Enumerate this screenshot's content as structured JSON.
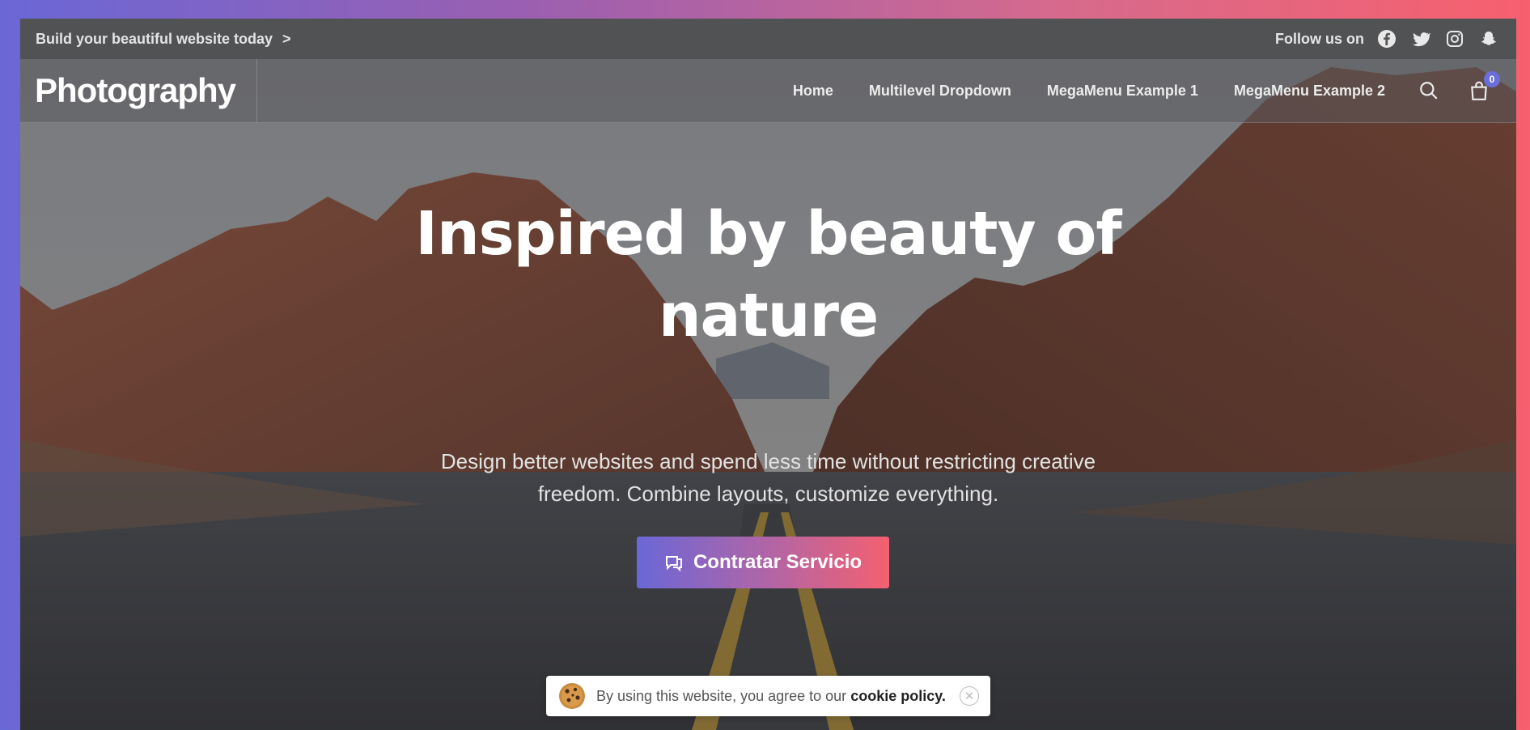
{
  "topbar": {
    "promo_text": "Build your beautiful website today",
    "promo_chevron": ">",
    "follow_label": "Follow us on",
    "social": [
      "facebook-icon",
      "twitter-icon",
      "instagram-icon",
      "snapchat-icon"
    ]
  },
  "navbar": {
    "brand": "Photography",
    "items": [
      {
        "label": "Home"
      },
      {
        "label": "Multilevel Dropdown"
      },
      {
        "label": "MegaMenu Example 1"
      },
      {
        "label": "MegaMenu Example 2"
      }
    ],
    "cart_count": "0"
  },
  "hero": {
    "title_line1": "Inspired by beauty of",
    "title_line2": "nature",
    "subtitle_line1": "Design better websites and spend less time without restricting creative",
    "subtitle_line2": "freedom. Combine layouts, customize everything.",
    "cta_label": "Contratar Servicio"
  },
  "cookie": {
    "text": "By using this website, you agree to our ",
    "link": "cookie policy.",
    "close": "✕"
  },
  "colors": {
    "accent_start": "#6b67d7",
    "accent_end": "#f46070",
    "badge": "#6b6fdc"
  }
}
